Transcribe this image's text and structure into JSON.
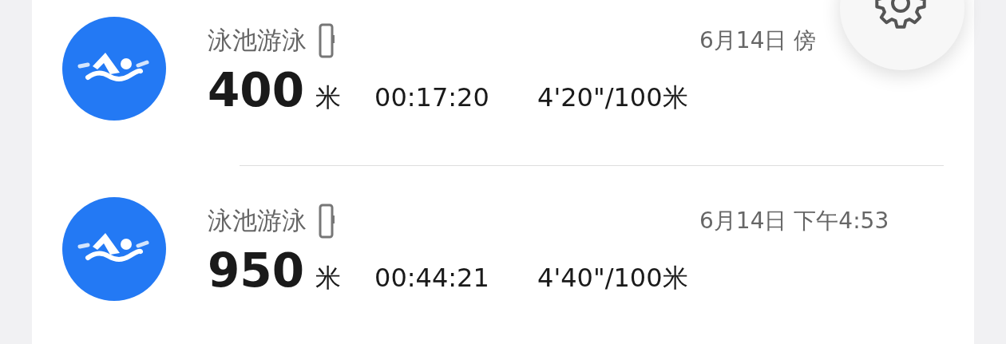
{
  "workouts": [
    {
      "title": "泳池游泳",
      "date": "6月14日 傍",
      "distance": "400",
      "unit": "米",
      "duration": "00:17:20",
      "pace": "4'20\"/100米"
    },
    {
      "title": "泳池游泳",
      "date": "6月14日 下午4:53",
      "distance": "950",
      "unit": "米",
      "duration": "00:44:21",
      "pace": "4'40\"/100米"
    }
  ]
}
